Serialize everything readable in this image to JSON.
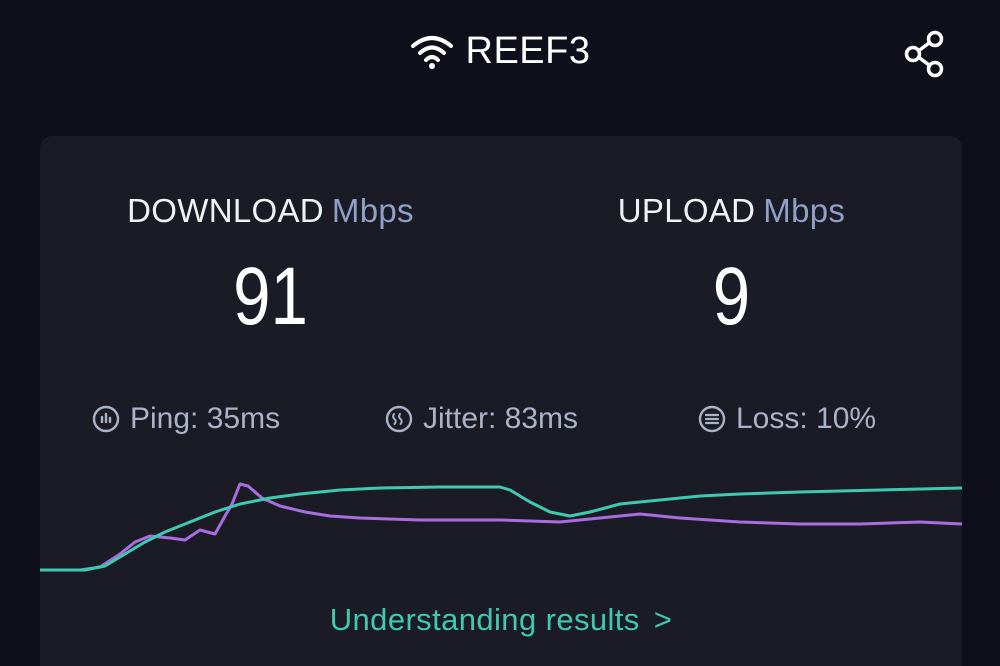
{
  "header": {
    "network_name": "REEF3",
    "wifi_icon": "wifi-icon",
    "share_icon": "share-icon"
  },
  "results": {
    "download": {
      "label": "DOWNLOAD",
      "unit": "Mbps",
      "value": "91"
    },
    "upload": {
      "label": "UPLOAD",
      "unit": "Mbps",
      "value": "9"
    }
  },
  "stats": {
    "ping": {
      "text": "Ping: 35ms",
      "icon": "ping-icon"
    },
    "jitter": {
      "text": "Jitter: 83ms",
      "icon": "jitter-icon"
    },
    "loss": {
      "text": "Loss: 10%",
      "icon": "loss-icon"
    }
  },
  "link": {
    "label": "Understanding results",
    "chevron": ">"
  },
  "colors": {
    "background": "#0f0f1c",
    "card": "#1b1b25",
    "unit": "#8fa0c8",
    "accent_teal": "#3ec9b0",
    "line_download": "#3ec9b0",
    "line_upload": "#a86de0"
  }
}
